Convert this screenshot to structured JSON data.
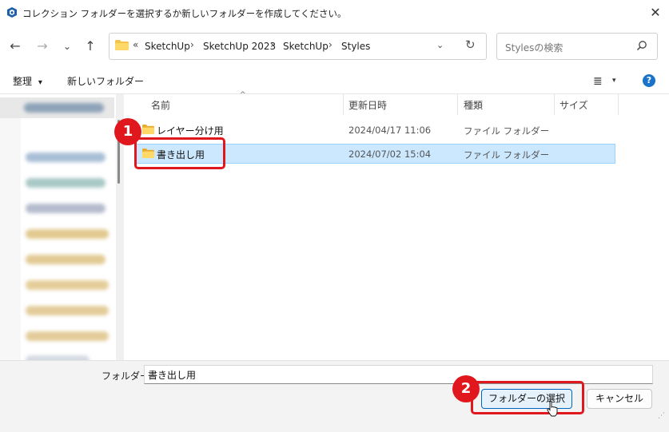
{
  "window": {
    "title": "コレクション フォルダーを選択するか新しいフォルダーを作成してください。",
    "close_glyph": "✕"
  },
  "nav_buttons": {
    "back": "←",
    "forward": "→",
    "recent": "⌄",
    "up": "↑"
  },
  "address": {
    "overflow": "«",
    "crumbs": [
      "SketchUp",
      "SketchUp 2023",
      "SketchUp",
      "Styles"
    ],
    "separator": "›",
    "dropdown_glyph": "⌄",
    "refresh_glyph": "↻"
  },
  "search": {
    "placeholder": "Stylesの検索"
  },
  "toolbar": {
    "organize_label": "整理",
    "organize_arrow": "▾",
    "new_folder_label": "新しいフォルダー",
    "view_glyph": "≣",
    "view_arrow": "▾",
    "help_glyph": "?"
  },
  "columns": {
    "name": "名前",
    "date": "更新日時",
    "type": "種類",
    "size": "サイズ",
    "sort_glyph": "^"
  },
  "files": [
    {
      "name": "レイヤー分け用",
      "date": "2024/04/17 11:06",
      "type": "ファイル フォルダー",
      "selected": false
    },
    {
      "name": "書き出し用",
      "date": "2024/07/02 15:04",
      "type": "ファイル フォルダー",
      "selected": true
    }
  ],
  "nav_expand_glyph": "›",
  "bottom": {
    "folder_label": "フォルダー:",
    "folder_value": "書き出し用",
    "select_button": "フォルダーの選択",
    "cancel_button": "キャンセル"
  },
  "annotations": {
    "step1": "1",
    "step2": "2"
  },
  "colors": {
    "accent": "#0067c0",
    "highlight": "#e0181e",
    "selection": "#cce8ff",
    "folder": "#f4c44e"
  }
}
